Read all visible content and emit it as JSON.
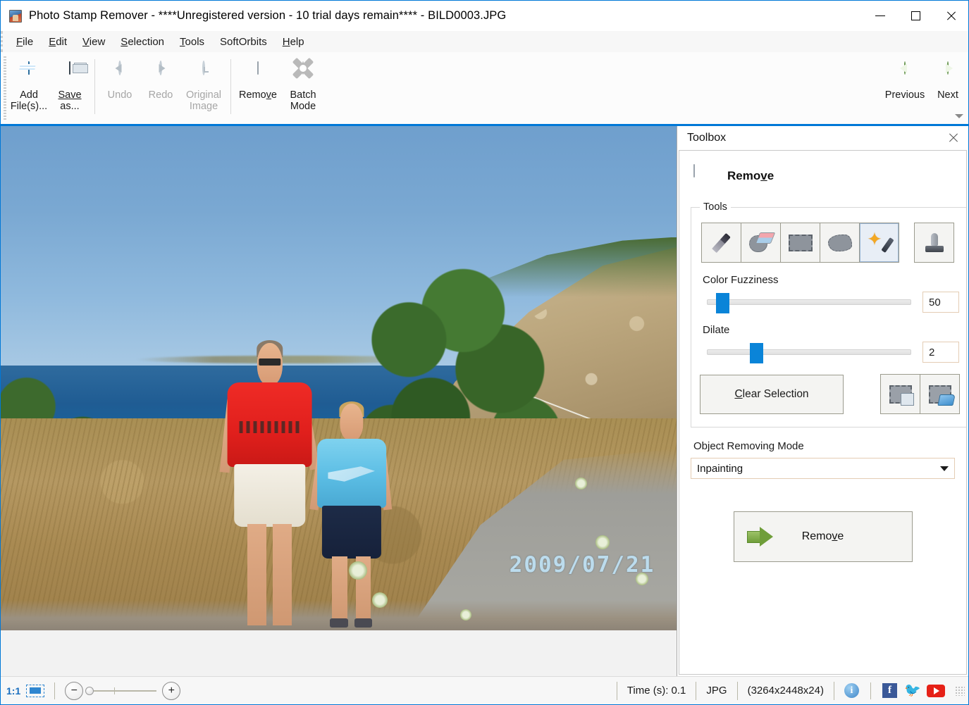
{
  "window": {
    "title": "Photo Stamp Remover - ****Unregistered version - 10 trial days remain**** - BILD0003.JPG",
    "minimize_label": "Minimize",
    "maximize_label": "Maximize",
    "close_label": "Close"
  },
  "menu": {
    "items": [
      {
        "label": "File",
        "accel": "F"
      },
      {
        "label": "Edit",
        "accel": "E"
      },
      {
        "label": "View",
        "accel": "V"
      },
      {
        "label": "Selection",
        "accel": "S"
      },
      {
        "label": "Tools",
        "accel": "T"
      },
      {
        "label": "SoftOrbits",
        "accel": ""
      },
      {
        "label": "Help",
        "accel": "H"
      }
    ]
  },
  "toolbar": {
    "add_files": "Add File(s)...",
    "save_as_line1": "Save",
    "save_as_line2": "as...",
    "undo": "Undo",
    "redo": "Redo",
    "original_line1": "Original",
    "original_line2": "Image",
    "remove": "Remove",
    "batch_line1": "Batch",
    "batch_line2": "Mode",
    "previous": "Previous",
    "next": "Next"
  },
  "toolbox": {
    "panel_title": "Toolbox",
    "header_label": "Remove",
    "tools_group_label": "Tools",
    "tools": [
      {
        "name": "marker",
        "selected": false
      },
      {
        "name": "eraser",
        "selected": false
      },
      {
        "name": "rectangle",
        "selected": false
      },
      {
        "name": "lasso",
        "selected": false
      },
      {
        "name": "magic-wand",
        "selected": true
      },
      {
        "name": "stamp",
        "selected": false
      }
    ],
    "color_fuzziness_label": "Color Fuzziness",
    "color_fuzziness_value": "50",
    "color_fuzziness_percent": 4,
    "dilate_label": "Dilate",
    "dilate_value": "2",
    "dilate_percent": 21,
    "clear_selection": "Clear Selection",
    "save_selection_label": "Save Selection",
    "load_selection_label": "Load Selection",
    "mode_label": "Object Removing Mode",
    "mode_value": "Inpainting",
    "mode_options": [
      "Inpainting"
    ],
    "remove_button": "Remove"
  },
  "canvas": {
    "photo_datestamp": "2009/07/21"
  },
  "statusbar": {
    "zoom_ratio": "1:1",
    "fit_label": "Fit to window",
    "zoom_out": "−",
    "zoom_in": "+",
    "time": "Time (s): 0.1",
    "format": "JPG",
    "dimensions": "(3264x2448x24)",
    "info_glyph": "i",
    "facebook_glyph": "f",
    "twitter_glyph": "🐦",
    "youtube_label": "YouTube"
  },
  "colors": {
    "accent": "#0078d7",
    "slider_thumb": "#0a84d8",
    "green_nav": "#5a9b33",
    "facebook": "#3b5998",
    "twitter": "#55acee",
    "youtube": "#e62117"
  }
}
